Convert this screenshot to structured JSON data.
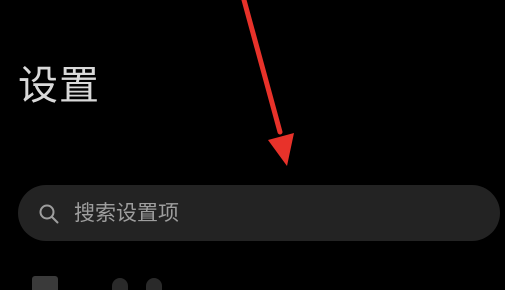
{
  "header": {
    "title": "设置"
  },
  "search": {
    "placeholder": "搜索设置项",
    "icon": "search-icon"
  },
  "annotation": {
    "type": "arrow",
    "color": "#e8322a"
  },
  "colors": {
    "background": "#000000",
    "search_background": "#232323",
    "title_text": "#d9d9d9",
    "placeholder_text": "#9e9e9e"
  }
}
